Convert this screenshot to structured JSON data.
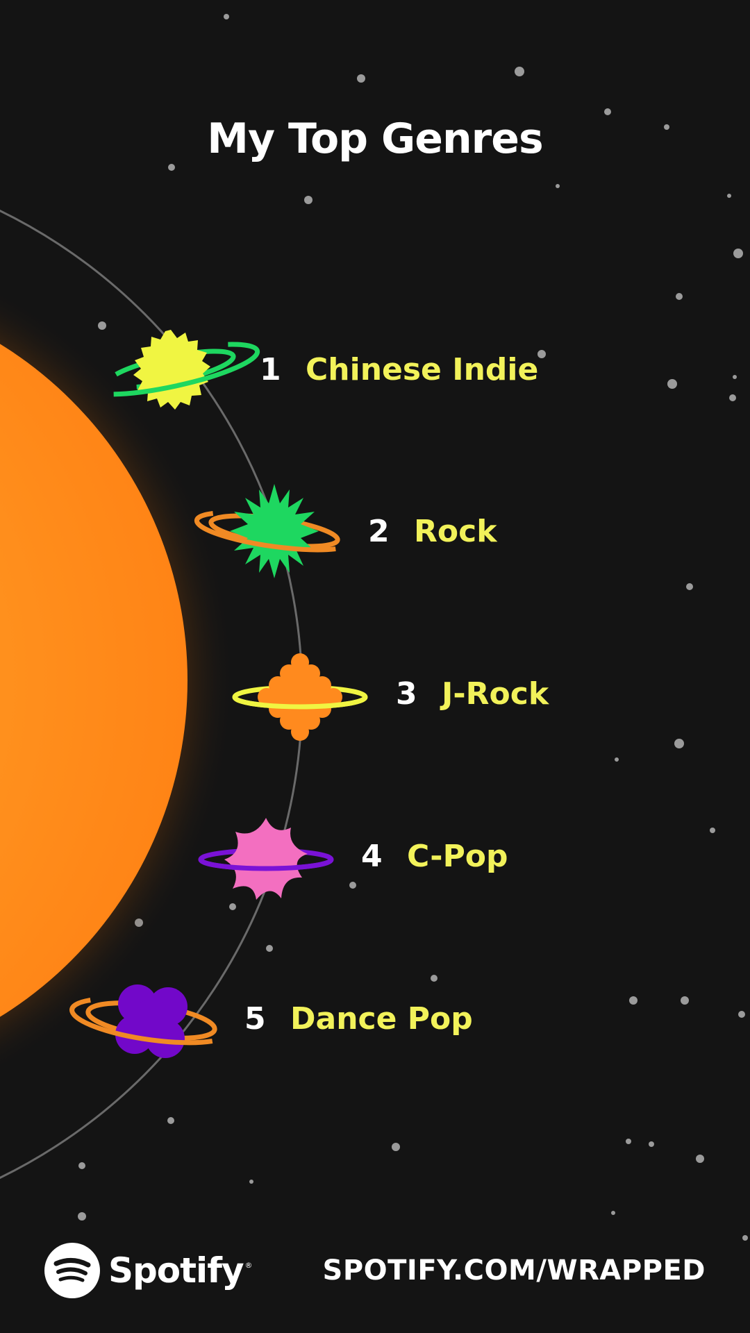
{
  "header": {
    "title": "My Top Genres"
  },
  "genres": [
    {
      "rank": "1",
      "name": "Chinese Indie",
      "planet_color": "#f0f542",
      "ring_color": "#1ed760"
    },
    {
      "rank": "2",
      "name": "Rock",
      "planet_color": "#1ed760",
      "ring_color": "#f08a24"
    },
    {
      "rank": "3",
      "name": "J-Rock",
      "planet_color": "#ff8a1e",
      "ring_color": "#f0f542"
    },
    {
      "rank": "4",
      "name": "C-Pop",
      "planet_color": "#f36fc0",
      "ring_color": "#7a12d6"
    },
    {
      "rank": "5",
      "name": "Dance Pop",
      "planet_color": "#7208c9",
      "ring_color": "#f08a24"
    }
  ],
  "colors": {
    "background": "#141414",
    "sun": "#ff8c1a",
    "genre_text": "#f2f25a",
    "rank_text": "#ffffff",
    "orbit": "#6a6a6a"
  },
  "footer": {
    "brand": "Spotify",
    "brand_mark": "®",
    "url": "SPOTIFY.COM/WRAPPED",
    "logo_icon": "spotify-logo-icon"
  }
}
